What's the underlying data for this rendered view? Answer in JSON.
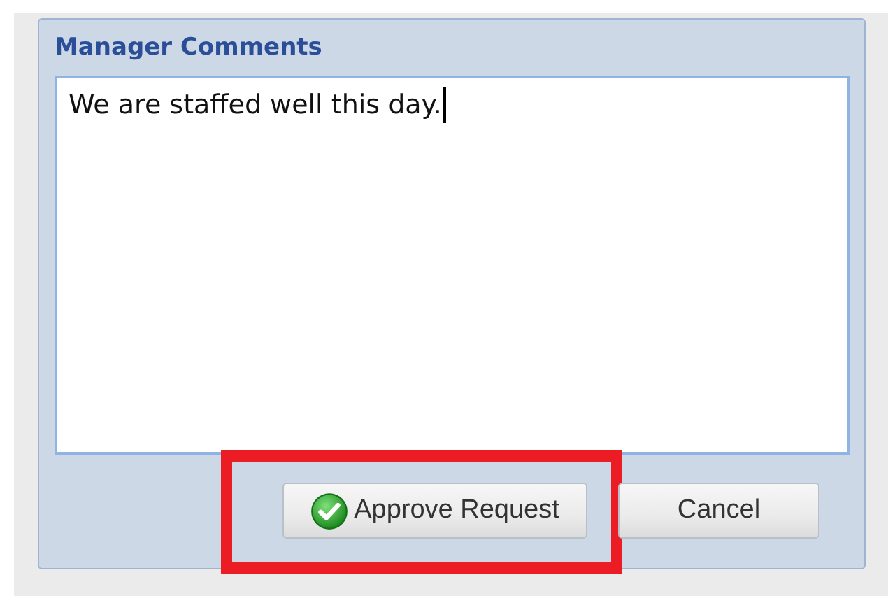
{
  "dialog": {
    "title": "Manager Comments",
    "comment": {
      "value": "We are staffed well this day.",
      "focused": true
    },
    "buttons": [
      {
        "label": "Approve Request",
        "kind": "approve",
        "highlighted": true
      },
      {
        "label": "Cancel",
        "kind": "plain",
        "highlighted": false
      }
    ]
  }
}
